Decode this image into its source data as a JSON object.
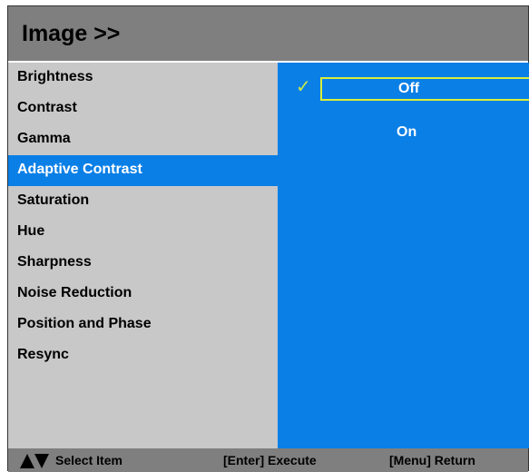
{
  "header": {
    "title": "Image >>"
  },
  "menu": {
    "items": [
      {
        "label": "Brightness"
      },
      {
        "label": "Contrast"
      },
      {
        "label": "Gamma"
      },
      {
        "label": "Adaptive Contrast"
      },
      {
        "label": "Saturation"
      },
      {
        "label": "Hue"
      },
      {
        "label": "Sharpness"
      },
      {
        "label": "Noise Reduction"
      },
      {
        "label": "Position and Phase"
      },
      {
        "label": "Resync"
      }
    ],
    "selected_index": 3
  },
  "options": {
    "items": [
      {
        "label": "Off"
      },
      {
        "label": "On"
      }
    ],
    "active_index": 0,
    "check_icon": "checkmark-icon"
  },
  "footer": {
    "select_label": "Select Item",
    "execute_label": "[Enter] Execute",
    "return_label": "[Menu] Return",
    "arrow_icon": "up-down-arrows-icon"
  },
  "colors": {
    "header_bg": "#7f7f7f",
    "panel_bg": "#c8c8c8",
    "selection_blue": "#0a7fe6",
    "highlight_yellow": "#d8ef3a"
  }
}
